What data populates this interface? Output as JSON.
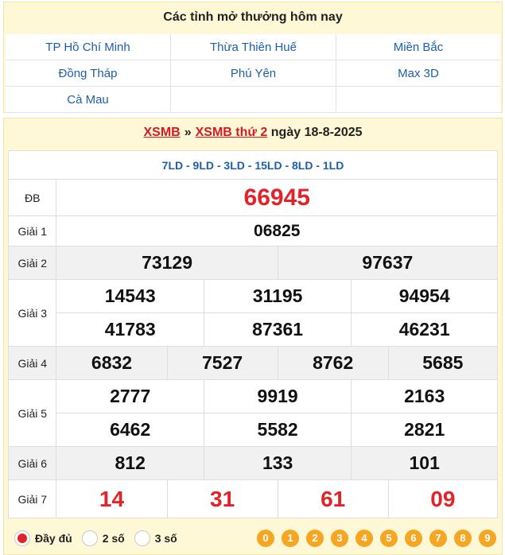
{
  "provinces": {
    "title": "Các tỉnh mở thưởng hôm nay",
    "items": [
      "TP Hồ Chí Minh",
      "Thừa Thiên Huế",
      "Miền Bắc",
      "Đồng Tháp",
      "Phú Yên",
      "Max 3D",
      "Cà Mau",
      "",
      ""
    ]
  },
  "result": {
    "breadcrumb": {
      "root": "XSMB",
      "separator": "»",
      "day_link": "XSMB thứ 2",
      "date": "ngày 18-8-2025"
    },
    "codes": "7LD - 9LD - 3LD - 15LD - 8LD - 1LD",
    "prizes": {
      "db": {
        "label": "ĐB",
        "numbers": [
          "66945"
        ]
      },
      "g1": {
        "label": "Giải 1",
        "numbers": [
          "06825"
        ]
      },
      "g2": {
        "label": "Giải 2",
        "numbers": [
          "73129",
          "97637"
        ]
      },
      "g3": {
        "label": "Giải 3",
        "numbers": [
          "14543",
          "31195",
          "94954",
          "41783",
          "87361",
          "46231"
        ]
      },
      "g4": {
        "label": "Giải 4",
        "numbers": [
          "6832",
          "7527",
          "8762",
          "5685"
        ]
      },
      "g5": {
        "label": "Giải 5",
        "numbers": [
          "2777",
          "9919",
          "2163",
          "6462",
          "5582",
          "2821"
        ]
      },
      "g6": {
        "label": "Giải 6",
        "numbers": [
          "812",
          "133",
          "101"
        ]
      },
      "g7": {
        "label": "Giải 7",
        "numbers": [
          "14",
          "31",
          "61",
          "09"
        ]
      }
    }
  },
  "display_options": {
    "selected": "Đầy đủ",
    "options": [
      "Đầy đủ",
      "2 số",
      "3 số"
    ]
  },
  "digit_filter": [
    "0",
    "1",
    "2",
    "3",
    "4",
    "5",
    "6",
    "7",
    "8",
    "9"
  ],
  "colors": {
    "accent_red": "#e3232a",
    "link_blue": "#1d5fa8",
    "header_bg": "#fff8d6",
    "digit_orange": "#f5a623"
  }
}
